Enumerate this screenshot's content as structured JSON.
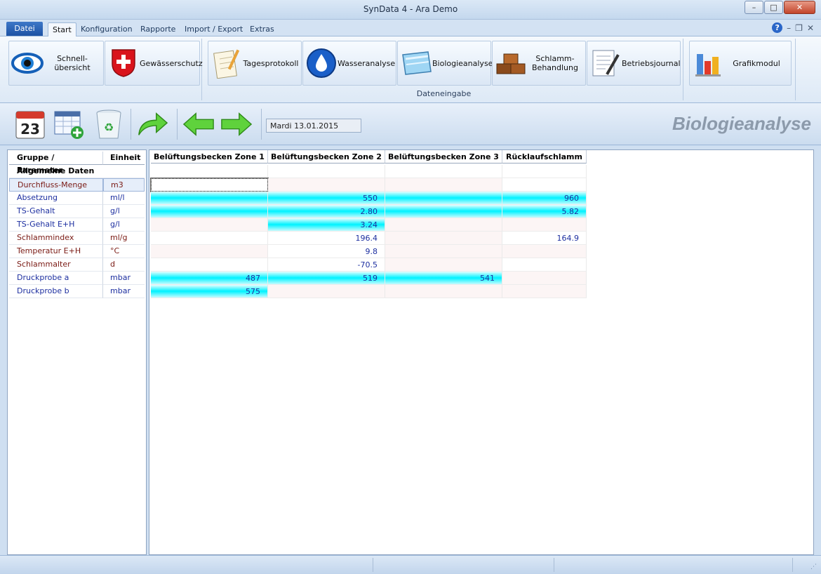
{
  "window": {
    "title": "SynData 4 - Ara Demo"
  },
  "tabs": {
    "file": "Datei",
    "start": "Start",
    "config": "Konfiguration",
    "reports": "Rapporte",
    "importexport": "Import / Export",
    "extras": "Extras"
  },
  "ribbon": {
    "quick": "Schnell-\nübersicht",
    "water": "Gewässerschutz",
    "daily": "Tagesprotokoll",
    "wateranalysis": "Wasseranalyse",
    "bio": "Biologieanalyse",
    "sludge": "Schlamm-\nBehandlung",
    "journal": "Betriebsjournal",
    "charts": "Grafikmodul",
    "group_label": "Dateneingabe"
  },
  "toolbar": {
    "calendar_day": "23",
    "date": "Mardi 13.01.2015",
    "page_title": "Biologieanalyse"
  },
  "left": {
    "header": {
      "param": "Gruppe / Parameter",
      "unit": "Einheit"
    },
    "group": "Allgemeine Daten",
    "rows": [
      {
        "name": "Durchfluss-Menge",
        "unit": "m3"
      },
      {
        "name": "Absetzung",
        "unit": "ml/l"
      },
      {
        "name": "TS-Gehalt",
        "unit": "g/l"
      },
      {
        "name": "TS-Gehalt E+H",
        "unit": "g/l"
      },
      {
        "name": "Schlammindex",
        "unit": "ml/g"
      },
      {
        "name": "Temperatur E+H",
        "unit": "°C"
      },
      {
        "name": "Schlammalter",
        "unit": "d"
      },
      {
        "name": "Druckprobe a",
        "unit": "mbar"
      },
      {
        "name": "Druckprobe b",
        "unit": "mbar"
      }
    ]
  },
  "grid": {
    "columns": [
      "Belüftungsbecken Zone 1",
      "Belüftungsbecken Zone 2",
      "Belüftungsbecken Zone 3",
      "Rücklaufschlamm"
    ],
    "rows": [
      [
        "",
        "",
        "",
        ""
      ],
      [
        "",
        "550",
        "",
        "960"
      ],
      [
        "",
        "2.80",
        "",
        "5.82"
      ],
      [
        "",
        "3.24",
        "",
        ""
      ],
      [
        "",
        "196.4",
        "",
        "164.9"
      ],
      [
        "",
        "9.8",
        "",
        ""
      ],
      [
        "",
        "-70.5",
        "",
        ""
      ],
      [
        "487",
        "519",
        "541",
        ""
      ],
      [
        "575",
        "",
        "",
        ""
      ]
    ]
  }
}
